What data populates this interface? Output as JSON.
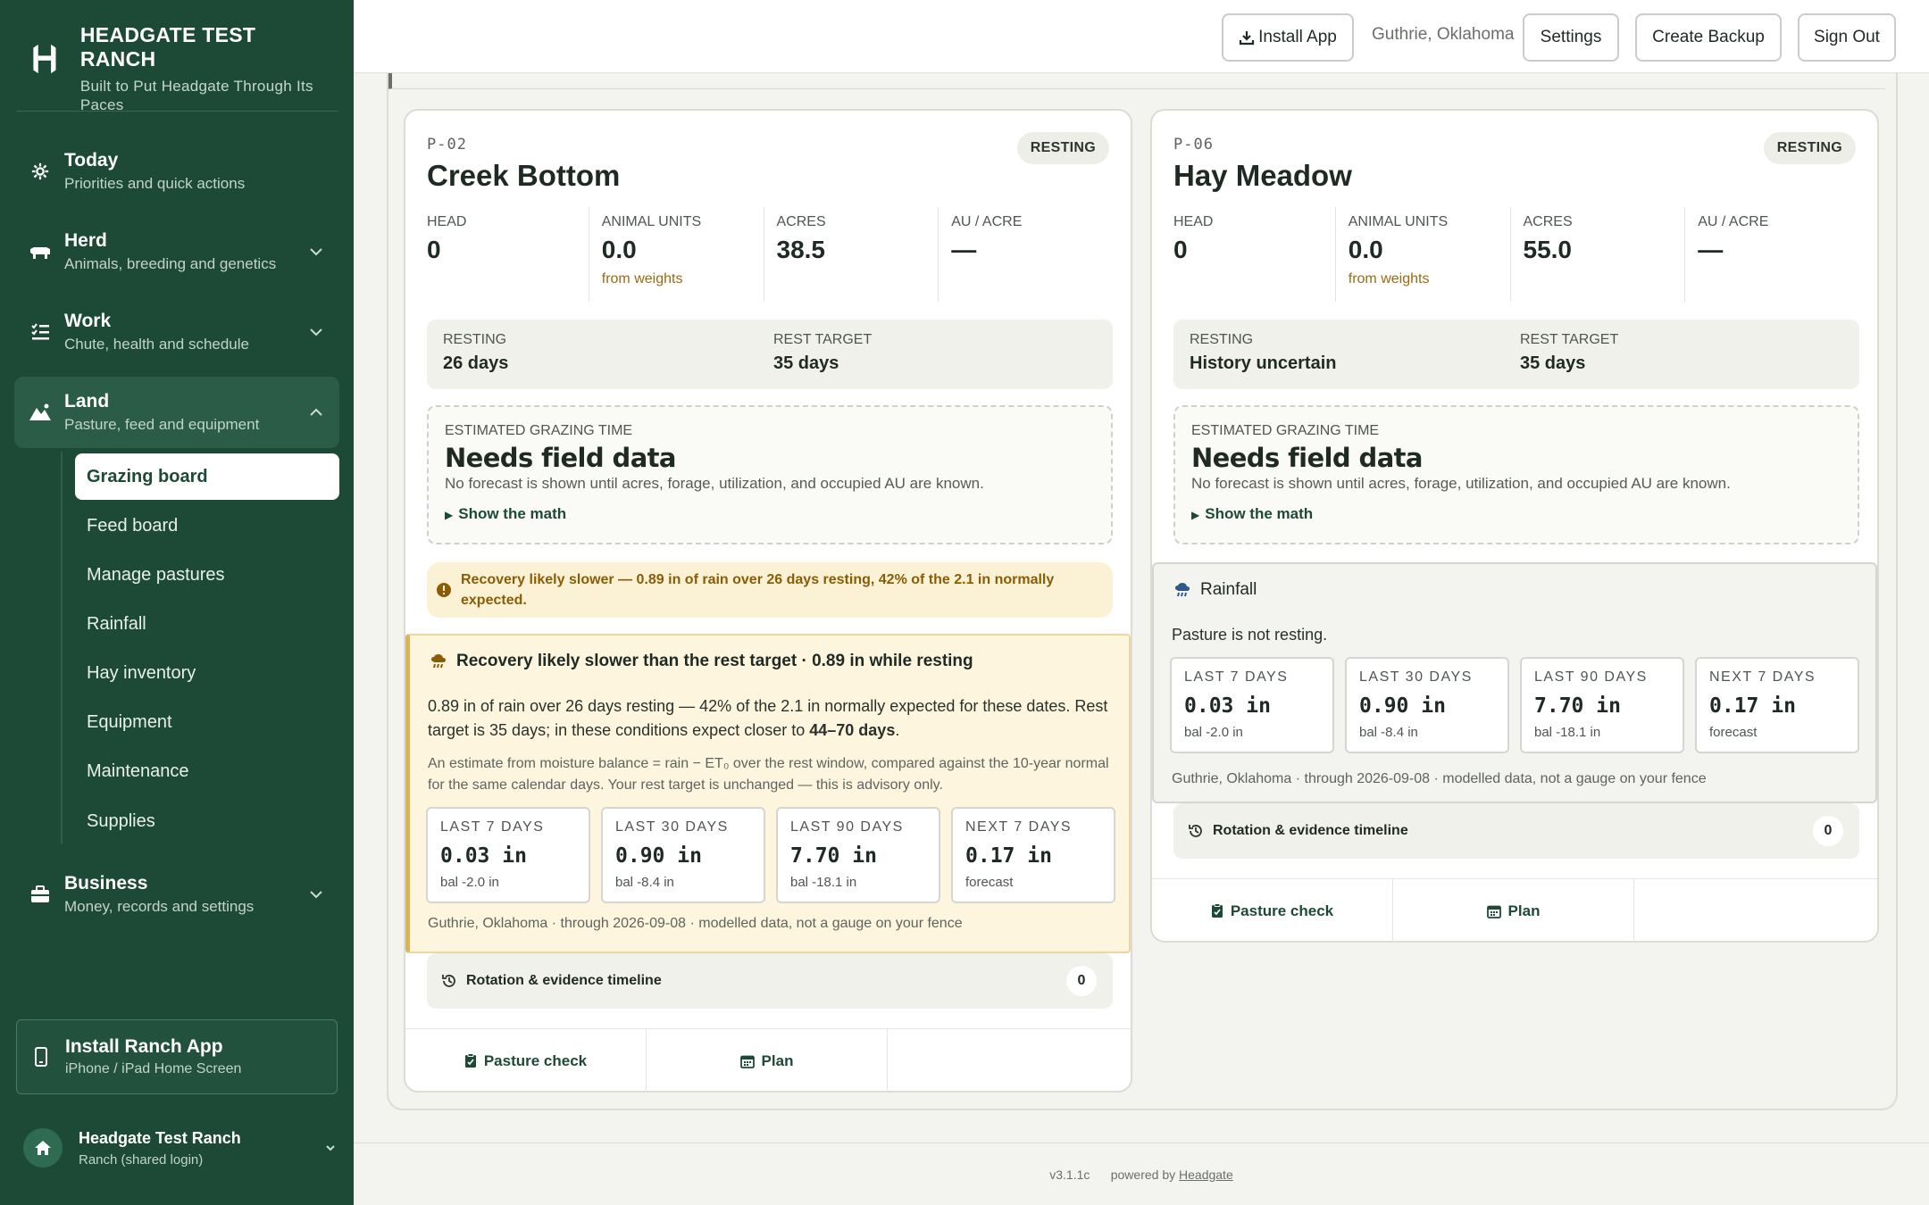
{
  "brand": {
    "title": "HEADGATE TEST RANCH",
    "subtitle": "Built to Put Headgate Through Its Paces",
    "logo_icon": "headgate-h-logo"
  },
  "nav": {
    "today": {
      "title": "Today",
      "sub": "Priorities and quick actions",
      "icon": "gear-icon"
    },
    "herd": {
      "title": "Herd",
      "sub": "Animals, breeding and genetics",
      "icon": "cow-icon"
    },
    "work": {
      "title": "Work",
      "sub": "Chute, health and schedule",
      "icon": "checklist-icon"
    },
    "land": {
      "title": "Land",
      "sub": "Pasture, feed and equipment",
      "icon": "mountain-icon"
    },
    "land_items": [
      "Grazing board",
      "Feed board",
      "Manage pastures",
      "Rainfall",
      "Hay inventory",
      "Equipment",
      "Maintenance",
      "Supplies"
    ],
    "business": {
      "title": "Business",
      "sub": "Money, records and settings",
      "icon": "briefcase-icon"
    }
  },
  "install_box": {
    "title": "Install Ranch App",
    "sub": "iPhone / iPad Home Screen"
  },
  "user": {
    "name": "Headgate Test Ranch",
    "role": "Ranch (shared login)"
  },
  "topbar": {
    "install_label": "Install App",
    "location": "Guthrie, Oklahoma",
    "settings_label": "Settings",
    "backup_label": "Create Backup",
    "signout_label": "Sign Out"
  },
  "pastures": [
    {
      "id": "P-02",
      "name": "Creek Bottom",
      "status": "RESTING",
      "stats": {
        "head_label": "HEAD",
        "head": "0",
        "au_label": "ANIMAL UNITS",
        "au": "0.0",
        "au_note": "from weights",
        "acres_label": "ACRES",
        "acres": "38.5",
        "au_acre_label": "AU / ACRE",
        "au_acre": "—"
      },
      "rest": {
        "resting_label": "RESTING",
        "resting": "26 days",
        "target_label": "REST TARGET",
        "target": "35 days"
      },
      "estimate": {
        "label": "ESTIMATED GRAZING TIME",
        "title": "Needs field data",
        "note": "No forecast is shown until acres, forage, utilization, and occupied AU are known.",
        "math_label": "Show the math"
      },
      "alert": "Recovery likely slower — 0.89 in of rain over 26 days resting, 42% of the 2.1 in normally expected.",
      "rainfall": {
        "heading": "Recovery likely slower than the rest target · 0.89 in while resting",
        "body_a": "0.89 in of rain over 26 days resting — 42% of the 2.1 in normally expected for these dates. Rest target is 35 days; in these conditions expect closer to ",
        "body_bold": "44–70 days",
        "body_end": ".",
        "note": "An estimate from moisture balance = rain − ET₀ over the rest window, compared against the 10-year normal for the same calendar days. Your rest target is unchanged — this is advisory only.",
        "cells": [
          {
            "label": "LAST 7 DAYS",
            "value": "0.03 in",
            "sub": "bal -2.0 in"
          },
          {
            "label": "LAST 30 DAYS",
            "value": "0.90 in",
            "sub": "bal -8.4 in"
          },
          {
            "label": "LAST 90 DAYS",
            "value": "7.70 in",
            "sub": "bal -18.1 in"
          },
          {
            "label": "NEXT 7 DAYS",
            "value": "0.17 in",
            "sub": "forecast"
          }
        ],
        "footer": "Guthrie, Oklahoma · through 2026-09-08 · modelled data, not a gauge on your fence"
      },
      "timeline": {
        "label": "Rotation & evidence timeline",
        "count": "0"
      },
      "actions": {
        "check": "Pasture check",
        "plan": "Plan"
      }
    },
    {
      "id": "P-06",
      "name": "Hay Meadow",
      "status": "RESTING",
      "stats": {
        "head_label": "HEAD",
        "head": "0",
        "au_label": "ANIMAL UNITS",
        "au": "0.0",
        "au_note": "from weights",
        "acres_label": "ACRES",
        "acres": "55.0",
        "au_acre_label": "AU / ACRE",
        "au_acre": "—"
      },
      "rest": {
        "resting_label": "RESTING",
        "resting": "History uncertain",
        "target_label": "REST TARGET",
        "target": "35 days"
      },
      "estimate": {
        "label": "ESTIMATED GRAZING TIME",
        "title": "Needs field data",
        "note": "No forecast is shown until acres, forage, utilization, and occupied AU are known.",
        "math_label": "Show the math"
      },
      "rainfall": {
        "heading": "Rainfall",
        "body": "Pasture is not resting.",
        "cells": [
          {
            "label": "LAST 7 DAYS",
            "value": "0.03 in",
            "sub": "bal -2.0 in"
          },
          {
            "label": "LAST 30 DAYS",
            "value": "0.90 in",
            "sub": "bal -8.4 in"
          },
          {
            "label": "LAST 90 DAYS",
            "value": "7.70 in",
            "sub": "bal -18.1 in"
          },
          {
            "label": "NEXT 7 DAYS",
            "value": "0.17 in",
            "sub": "forecast"
          }
        ],
        "footer": "Guthrie, Oklahoma · through 2026-09-08 · modelled data, not a gauge on your fence"
      },
      "timeline": {
        "label": "Rotation & evidence timeline",
        "count": "0"
      },
      "actions": {
        "check": "Pasture check",
        "plan": "Plan"
      }
    }
  ],
  "footer": {
    "version": "v3.1.1c",
    "powered": "powered by",
    "link": "Headgate"
  },
  "colors": {
    "sidebar": "#1d4a37",
    "accent_warn": "#8a5c06",
    "warn_bg": "#fdf5dd"
  }
}
